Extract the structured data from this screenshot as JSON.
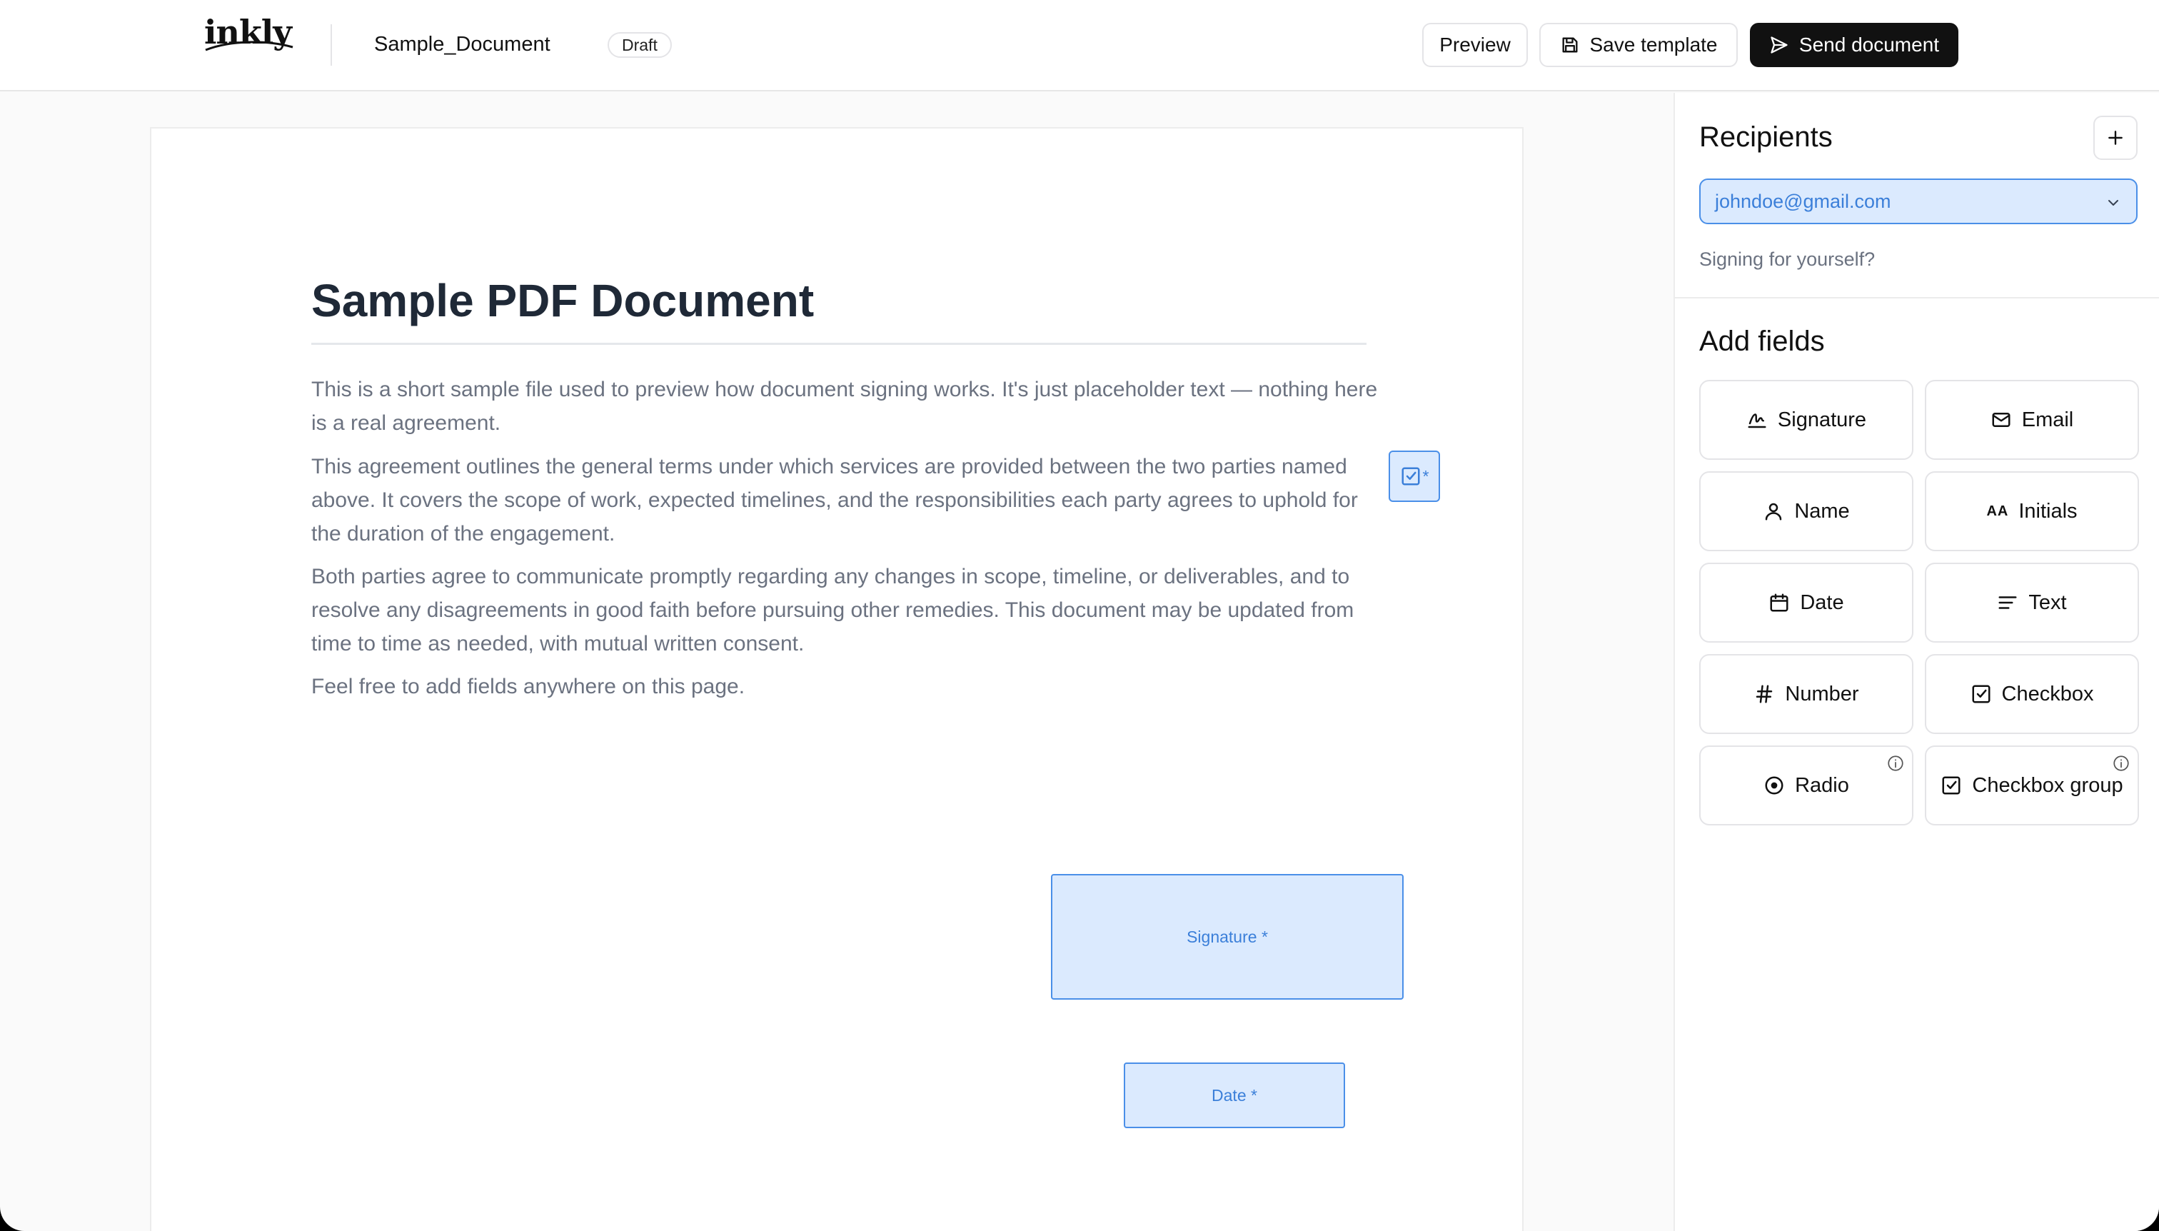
{
  "header": {
    "logo": "inkly",
    "document_name": "Sample_Document",
    "status_badge": "Draft",
    "preview_label": "Preview",
    "save_label": "Save template",
    "send_label": "Send document"
  },
  "document": {
    "title": "Sample PDF Document",
    "paragraphs": [
      "This is a short sample file used to preview how document signing works. It's just placeholder text — nothing here is a real agreement.",
      "This agreement outlines the general terms under which services are provided between the two parties named above. It covers the scope of work, expected timelines, and the responsibilities each party agrees to uphold for the duration of the engagement.",
      "Both parties agree to communicate promptly regarding any changes in scope, timeline, or deliverables, and to resolve any disagreements in good faith before pursuing other remedies. This document may be updated from time to time as needed, with mutual written consent.",
      "Feel free to add fields anywhere on this page."
    ],
    "placed_fields": {
      "checkbox_required": "*",
      "signature": "Signature *",
      "date": "Date *"
    }
  },
  "panel": {
    "recipients_title": "Recipients",
    "recipient_selected": "johndoe@gmail.com",
    "self_sign_link": "Signing for yourself?",
    "add_fields_title": "Add fields",
    "fields": [
      {
        "label": "Signature",
        "icon": "signature-icon"
      },
      {
        "label": "Email",
        "icon": "mail-icon"
      },
      {
        "label": "Name",
        "icon": "user-icon"
      },
      {
        "label": "Initials",
        "icon": "initials-icon",
        "glyph": "AA"
      },
      {
        "label": "Date",
        "icon": "calendar-icon"
      },
      {
        "label": "Text",
        "icon": "text-lines-icon"
      },
      {
        "label": "Number",
        "icon": "hash-icon"
      },
      {
        "label": "Checkbox",
        "icon": "checkbox-icon"
      },
      {
        "label": "Radio",
        "icon": "radio-icon"
      },
      {
        "label": "Checkbox group",
        "icon": "checkbox-icon"
      }
    ]
  },
  "colors": {
    "accent_blue": "#4a8fe8",
    "field_fill": "#dbeafe",
    "primary_button": "#111111"
  }
}
